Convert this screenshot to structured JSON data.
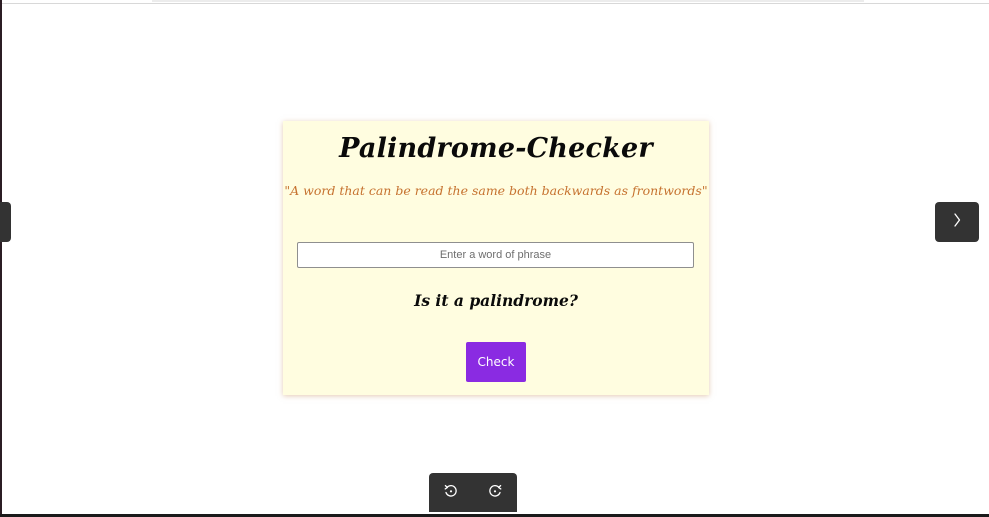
{
  "app": {
    "title": "Palindrome-Checker",
    "quote": "\"A word that can be read the same both backwards as frontwords\""
  },
  "input": {
    "placeholder": "Enter a word of phrase",
    "value": ""
  },
  "result": {
    "text": "Is it a palindrome?"
  },
  "check_button": {
    "label": "Check",
    "color": "#8a2be2"
  },
  "colors": {
    "card_background": "#fffde0",
    "quote": "#c6722f",
    "controls": "#333333"
  },
  "navigation": {
    "prev_icon": "chevron-left-icon",
    "next_icon": "chevron-right-icon"
  },
  "toolbar": {
    "rotate_left_icon": "rotate-left-icon",
    "rotate_right_icon": "rotate-right-icon"
  }
}
